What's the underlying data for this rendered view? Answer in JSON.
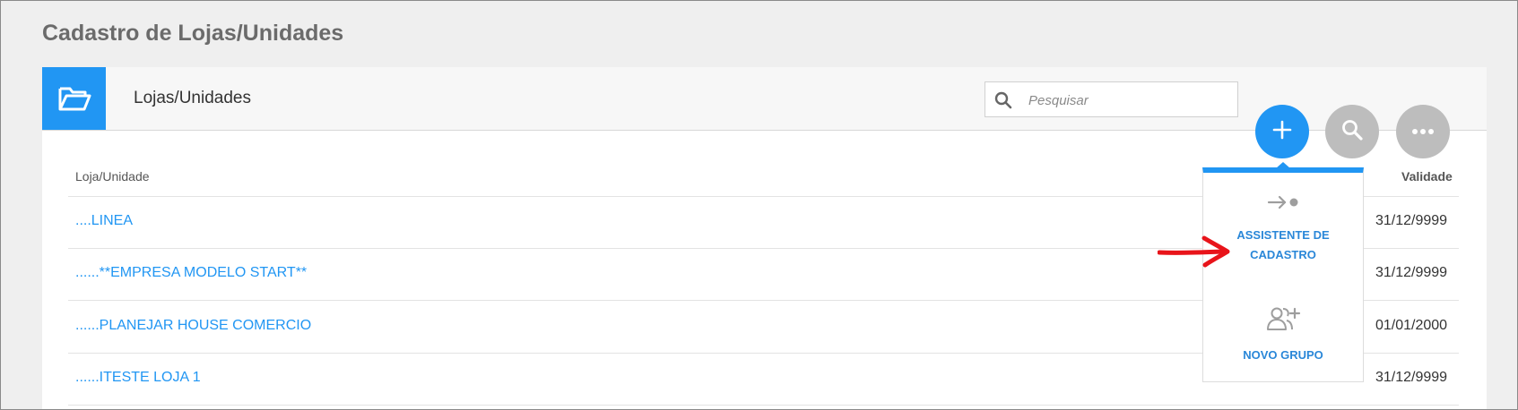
{
  "page": {
    "title": "Cadastro de Lojas/Unidades"
  },
  "panel": {
    "title": "Lojas/Unidades",
    "icon": "folder-open-icon",
    "search": {
      "placeholder": "Pesquisar"
    }
  },
  "fabs": {
    "add_icon": "plus-icon",
    "search_icon": "search-icon",
    "more_icon": "more-horizontal-icon"
  },
  "table": {
    "headers": {
      "loja": "Loja/Unidade",
      "validade": "Validade"
    },
    "rows": [
      {
        "name": "....LINEA",
        "validade": "31/12/9999"
      },
      {
        "name": "......**EMPRESA MODELO  START**",
        "validade": "31/12/9999"
      },
      {
        "name": "......PLANEJAR HOUSE COMERCIO",
        "validade": "01/01/2000"
      },
      {
        "name": "......ITESTE LOJA 1",
        "validade": "31/12/9999"
      }
    ]
  },
  "dropdown": {
    "items": [
      {
        "line1": "ASSISTENTE DE",
        "line2": "CADASTRO",
        "icon": "arrow-dot-icon"
      },
      {
        "line1": "NOVO GRUPO",
        "icon": "add-group-icon"
      }
    ]
  },
  "colors": {
    "accent": "#2196f3",
    "annotation": "#e8141a"
  }
}
